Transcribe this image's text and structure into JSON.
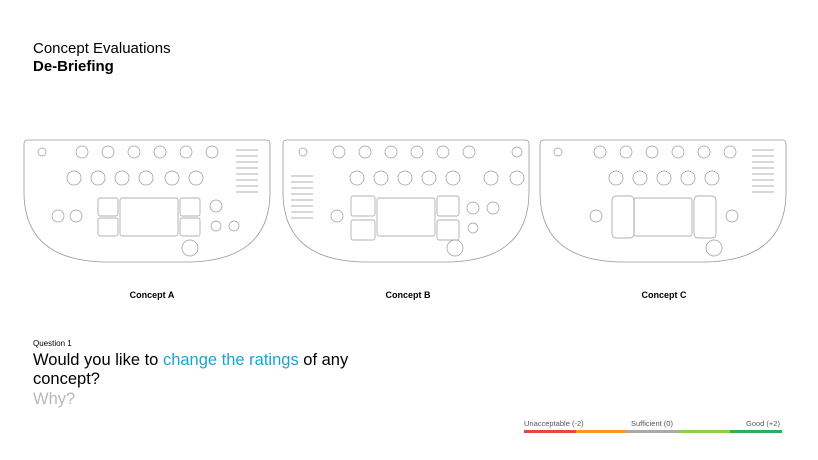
{
  "header": {
    "title": "Concept Evaluations",
    "subtitle": "De-Briefing"
  },
  "concepts": [
    {
      "label": "Concept A"
    },
    {
      "label": "Concept B"
    },
    {
      "label": "Concept C"
    }
  ],
  "question": {
    "number": "Question 1",
    "text_before": "Would you like to ",
    "text_highlight": "change the ratings",
    "text_after": " of any concept?",
    "why": "Why?"
  },
  "rating_scale": {
    "low": "Unacceptable (-2)",
    "mid": "Sufficient (0)",
    "high": "Good (+2)",
    "colors": [
      "#e8473f",
      "#f39a1c",
      "#aaaaaa",
      "#8ccf4f",
      "#2fae5a"
    ]
  }
}
